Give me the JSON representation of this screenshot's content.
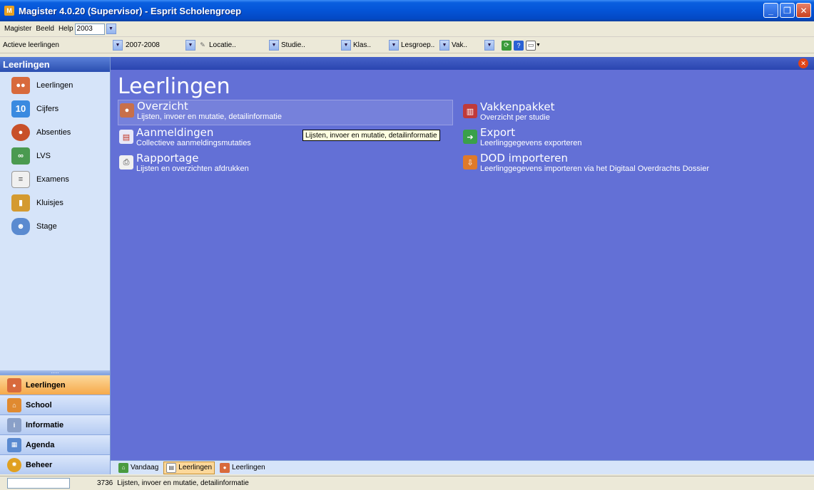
{
  "window": {
    "title": "Magister 4.0.20 (Supervisor) - Esprit Scholengroep",
    "app_icon": "magister-icon"
  },
  "menu": {
    "items": [
      "Magister",
      "Beeld",
      "Help"
    ],
    "year": "2003"
  },
  "filters": {
    "view": "Actieve leerlingen",
    "schoolyear": "2007-2008",
    "locatie": "Locatie..",
    "studie": "Studie..",
    "klas": "Klas..",
    "lesgroep": "Lesgroep..",
    "vak": "Vak.."
  },
  "sidebar": {
    "header": "Leerlingen",
    "items": [
      {
        "label": "Leerlingen",
        "icon": "students-icon"
      },
      {
        "label": "Cijfers",
        "icon": "grades-icon"
      },
      {
        "label": "Absenties",
        "icon": "absences-icon"
      },
      {
        "label": "LVS",
        "icon": "lvs-icon"
      },
      {
        "label": "Examens",
        "icon": "exams-icon"
      },
      {
        "label": "Kluisjes",
        "icon": "lockers-icon"
      },
      {
        "label": "Stage",
        "icon": "internship-icon"
      }
    ],
    "nav": [
      {
        "label": "Leerlingen",
        "active": true
      },
      {
        "label": "School",
        "active": false
      },
      {
        "label": "Informatie",
        "active": false
      },
      {
        "label": "Agenda",
        "active": false
      },
      {
        "label": "Beheer",
        "active": false
      }
    ]
  },
  "main": {
    "title": "Leerlingen",
    "entries": [
      {
        "title": "Overzicht",
        "desc": "Lijsten, invoer en mutatie, detailinformatie",
        "icon": "overview-icon"
      },
      {
        "title": "Aanmeldingen",
        "desc": "Collectieve aanmeldingsmutaties",
        "icon": "registrations-icon"
      },
      {
        "title": "Rapportage",
        "desc": "Lijsten en overzichten afdrukken",
        "icon": "printer-icon"
      },
      {
        "title": "Vakkenpakket",
        "desc": "Overzicht per studie",
        "icon": "books-icon"
      },
      {
        "title": "Export",
        "desc": "Leerlinggegevens exporteren",
        "icon": "export-icon"
      },
      {
        "title": "DOD importeren",
        "desc": "Leerlinggegevens importeren via het Digitaal Overdrachts Dossier",
        "icon": "import-icon"
      }
    ],
    "tooltip": "Lijsten, invoer en mutatie, detailinformatie"
  },
  "tabs": [
    {
      "label": "Vandaag",
      "active": false
    },
    {
      "label": "Leerlingen",
      "active": true
    },
    {
      "label": "Leerlingen",
      "active": false
    }
  ],
  "status": {
    "count": "3736",
    "text": "Lijsten, invoer en mutatie, detailinformatie"
  }
}
